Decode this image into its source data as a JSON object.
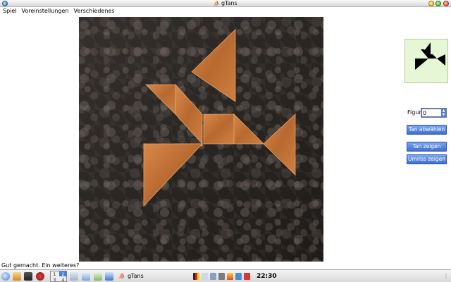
{
  "window": {
    "title": "gTans"
  },
  "menu": [
    "Spiel",
    "Voreinstellungen",
    "Verschiedenes"
  ],
  "status": "Gut gemacht. Ein weiteres?",
  "panel": {
    "figur_label": "Figur",
    "figur_value": "0",
    "deselect_label": "Tan abwählen",
    "show_tan_label": "Tan zeigen",
    "show_outline_label": "Umriss zeigen"
  },
  "taskbar": {
    "pager": [
      "1",
      "2",
      "3",
      "4"
    ],
    "active_workspace": "2",
    "task_title": "gTans",
    "clock": "22:30"
  },
  "colors": {
    "tan": "#c8773a",
    "board": "#2a2624",
    "preview_bg": "#e6f7d6",
    "button": "#4c7bd6"
  }
}
